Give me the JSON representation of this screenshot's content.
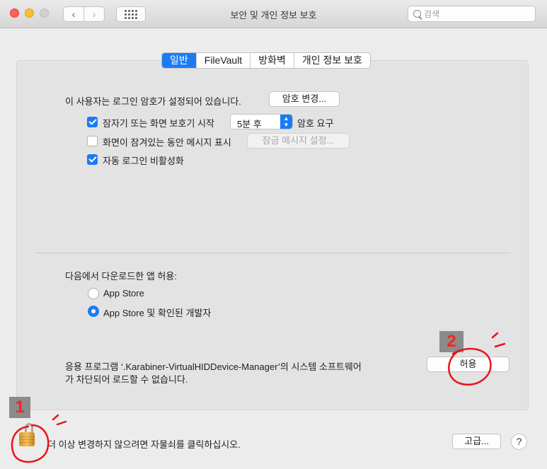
{
  "window": {
    "title": "보안 및 개인 정보 보호"
  },
  "toolbar": {
    "back": "‹",
    "forward": "›"
  },
  "search": {
    "placeholder": "검색"
  },
  "tabs": [
    {
      "label": "일반",
      "active": true
    },
    {
      "label": "FileVault",
      "active": false
    },
    {
      "label": "방화벽",
      "active": false
    },
    {
      "label": "개인 정보 보호",
      "active": false
    }
  ],
  "general": {
    "password_text": "이 사용자는 로그인 암호가 설정되어 있습니다.",
    "change_password_button": "암호 변경...",
    "require_password": {
      "label": "잠자기 또는 화면 보호기 시작",
      "checked": true,
      "select_value": "5분 후",
      "suffix": "암호 요구"
    },
    "show_message": {
      "label": "화면이 잠겨있는 동안 메시지 표시",
      "checked": false,
      "button": "잠금 메시지 설정..."
    },
    "disable_auto_login": {
      "label": "자동 로그인 비활성화",
      "checked": true
    }
  },
  "downloads": {
    "heading": "다음에서 다운로드한 앱 허용:",
    "options": [
      {
        "label": "App Store",
        "selected": false
      },
      {
        "label": "App Store 및 확인된 개발자",
        "selected": true
      }
    ]
  },
  "blocked": {
    "line1": "응용 프로그램 ‘.Karabiner-VirtualHIDDevice-Manager’의 시스템 소프트웨어",
    "line2": "가 차단되어 로드할 수 없습니다.",
    "allow_button": "허용"
  },
  "footer": {
    "lock_text": "더 이상 변경하지 않으려면 자물쇠를 클릭하십시오.",
    "advanced_button": "고급...",
    "help_button": "?"
  },
  "annotations": {
    "badge1": "1",
    "badge2": "2",
    "mark_color": "#e8141b"
  },
  "colors": {
    "accent": "#1a7bf5"
  }
}
